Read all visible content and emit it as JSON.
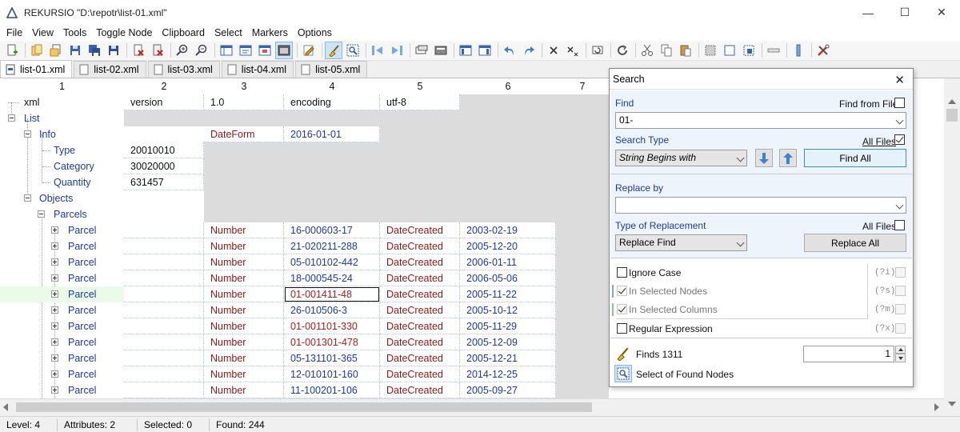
{
  "window": {
    "title": "REKURSIO \"D:\\repotr\\list-01.xml\"",
    "minimize": "—",
    "maximize": "☐",
    "close": "✕"
  },
  "menu": [
    "File",
    "View",
    "Tools",
    "Toggle Node",
    "Clipboard",
    "Select",
    "Markers",
    "Options"
  ],
  "tabs": [
    "list-01.xml",
    "list-02.xml",
    "list-03.xml",
    "list-04.xml",
    "list-05.xml"
  ],
  "columns": [
    "1",
    "2",
    "3",
    "4",
    "5",
    "6",
    "7"
  ],
  "tree": {
    "xml": "xml",
    "list": "List",
    "info": "Info",
    "type": "Type",
    "category": "Category",
    "quantity": "Quantity",
    "objects": "Objects",
    "parcels": "Parcels",
    "parcel": "Parcel"
  },
  "header_row": {
    "c2": "version",
    "c3": "1.0",
    "c4": "encoding",
    "c5": "utf-8"
  },
  "info_row": {
    "c3": "DateForm",
    "c4": "2016-01-01"
  },
  "type_row": {
    "c2": "20010010"
  },
  "category_row": {
    "c2": "30020000"
  },
  "quantity_row": {
    "c2": "631457"
  },
  "parcels": [
    {
      "label": "Parcel",
      "attr": "Number",
      "id": "16-000603-17",
      "id_match": false,
      "date_attr": "DateCreated",
      "date": "2003-02-19"
    },
    {
      "label": "Parcel",
      "attr": "Number",
      "id": "21-020211-288",
      "id_match": false,
      "date_attr": "DateCreated",
      "date": "2005-12-20"
    },
    {
      "label": "Parcel",
      "attr": "Number",
      "id": "05-010102-442",
      "id_match": false,
      "date_attr": "DateCreated",
      "date": "2006-01-11"
    },
    {
      "label": "Parcel",
      "attr": "Number",
      "id": "18-000545-24",
      "id_match": false,
      "date_attr": "DateCreated",
      "date": "2006-05-06"
    },
    {
      "label": "Parcel",
      "attr": "Number",
      "id": "01-001411-48",
      "id_match": true,
      "date_attr": "DateCreated",
      "date": "2005-11-22"
    },
    {
      "label": "Parcel",
      "attr": "Number",
      "id": "26-010506-3",
      "id_match": false,
      "date_attr": "DateCreated",
      "date": "2005-10-12"
    },
    {
      "label": "Parcel",
      "attr": "Number",
      "id": "01-001101-330",
      "id_match": true,
      "date_attr": "DateCreated",
      "date": "2005-11-29"
    },
    {
      "label": "Parcel",
      "attr": "Number",
      "id": "01-001301-478",
      "id_match": true,
      "date_attr": "DateCreated",
      "date": "2005-12-09"
    },
    {
      "label": "Parcel",
      "attr": "Number",
      "id": "05-131101-365",
      "id_match": false,
      "date_attr": "DateCreated",
      "date": "2005-12-21"
    },
    {
      "label": "Parcel",
      "attr": "Number",
      "id": "12-010101-160",
      "id_match": false,
      "date_attr": "DateCreated",
      "date": "2014-12-25"
    },
    {
      "label": "Parcel",
      "attr": "Number",
      "id": "11-100201-106",
      "id_match": false,
      "date_attr": "DateCreated",
      "date": "2005-09-27"
    }
  ],
  "status": {
    "level": "Level: 4",
    "attributes": "Attributes: 2",
    "selected": "Selected: 0",
    "found": "Found: 244"
  },
  "search": {
    "title": "Search",
    "find_label": "Find",
    "find_from_file": "Find from File",
    "find_value": "01-",
    "search_type_label": "Search Type",
    "all_files": "All Files",
    "search_type_value": "String Begins with",
    "find_all": "Find All",
    "replace_by_label": "Replace by",
    "replace_value": "",
    "type_of_replacement_label": "Type of Replacement",
    "all_files_2": "All Files",
    "replacement_value": "Replace Find",
    "replace_all": "Replace All",
    "ignore_case": "Ignore Case",
    "ignore_case_code": "(?i)",
    "in_selected_nodes": "In Selected Nodes",
    "in_selected_nodes_code": "(?s)",
    "in_selected_columns": "In Selected Columns",
    "in_selected_columns_code": "(?m)",
    "regular_expression": "Regular Expression",
    "regular_expression_code": "(?x)",
    "finds": "Finds 1311",
    "finds_index": "1",
    "select_found": "Select of Found Nodes"
  },
  "colors": {
    "accent": "#1f3a9e",
    "match": "#a82020",
    "gray": "#dcdcdc",
    "highlight": "#eafbe9"
  }
}
